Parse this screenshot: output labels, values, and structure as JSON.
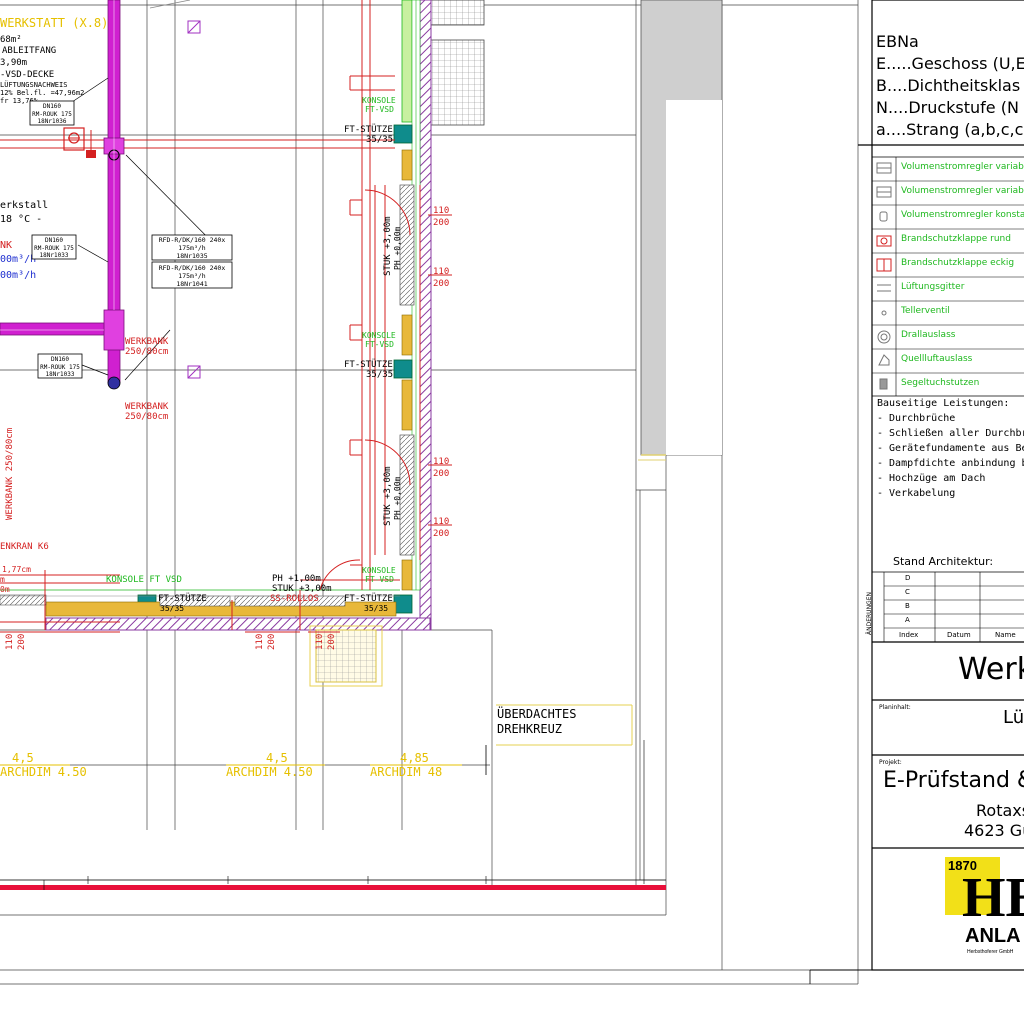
{
  "drawing": {
    "room_labels": {
      "werkstatt": "WERKSTATT (X.8)",
      "area": "68m²",
      "ableitfang": "ABLEITFANG",
      "decke": "-VSD-DECKE",
      "height": "3,90m",
      "nachweis": "LÜFTUNGSNACHWEIS",
      "belueft1": "12% Bel.fl. =47,96m2",
      "belueft2": "fr 13,76%",
      "lager": "erkstall",
      "temp": "18 °C -",
      "flow1": "00m³/h",
      "flow2": "00m³/h",
      "nk": "NK",
      "werkbank_left": "WERKBANK 250/80cm",
      "kran": "ENKRAN K6",
      "ueberdacht1": "ÜBERDACHTES",
      "ueberdacht2": "DREHKREUZ"
    },
    "tags": {
      "dn160a": [
        "DN160",
        "RM-ROUK 175",
        "18Nr1036"
      ],
      "dn160b": [
        "DN160",
        "RM-ROUK 175",
        "18Nr1033"
      ],
      "dn160c": [
        "DN160",
        "RM-ROUK 175",
        "18Nr1033"
      ],
      "rfd1": [
        "RFD-R/DK/160 240x",
        "175m³/h",
        "18Nr1035"
      ],
      "rfd2": [
        "RFD-R/DK/160 240x",
        "175m³/h",
        "18Nr1041"
      ]
    },
    "werkbank1": [
      "WERKBANK",
      "250/80cm"
    ],
    "werkbank2": [
      "WERKBANK",
      "250/80cm"
    ],
    "konsole": "KONSOLE",
    "konsole_vsd": "FT-VSD",
    "konsole_long": "KONSOLE FT VSD",
    "ft_stuetze": "FT-STÜTZE",
    "ft_dim": "35/35",
    "stuk": "STUK +3,00m",
    "ph": "PH +0,00m",
    "ph2": "PH +1,00m",
    "stuk2": "STUK +3,00m",
    "rollos": "SS-ROLLOS",
    "dims": {
      "a110": "110",
      "a200": "200",
      "b177": "1,77cm",
      "b_m": "m",
      "b_0m": "0m"
    },
    "archdim": [
      "4,5",
      "ARCHDIM 4.50",
      "4,5",
      "ARCHDIM 4.50",
      "4,85",
      "ARCHDIM 48"
    ]
  },
  "legend_header": {
    "title": "EBNa",
    "lines": [
      "E.....Geschoss (U,E",
      "B....Dichtheitsklas",
      "N....Druckstufe (N",
      "a....Strang (a,b,c,c"
    ]
  },
  "legend_rows": [
    {
      "label": "Volumenstromregler variabe",
      "color": "#1fb81f",
      "icon": "vvr-icon"
    },
    {
      "label": "Volumenstromregler variabe",
      "color": "#1fb81f",
      "icon": "vvr2-icon"
    },
    {
      "label": "Volumenstromregler konstan",
      "color": "#1fb81f",
      "icon": "kvr-icon"
    },
    {
      "label": "Brandschutzklappe rund",
      "color": "#1fb81f",
      "icon": "bsk-round-icon"
    },
    {
      "label": "Brandschutzklappe eckig",
      "color": "#1fb81f",
      "icon": "bsk-square-icon"
    },
    {
      "label": "Lüftungsgitter",
      "color": "#1fb81f",
      "icon": "grille-icon"
    },
    {
      "label": "Tellerventil",
      "color": "#1fb81f",
      "icon": "valve-icon"
    },
    {
      "label": "Drallauslass",
      "color": "#1fb81f",
      "icon": "swirl-icon"
    },
    {
      "label": "Quellluftauslass",
      "color": "#1fb81f",
      "icon": "displacement-icon"
    },
    {
      "label": "Segeltuchstutzen",
      "color": "#1fb81f",
      "icon": "canvas-icon"
    }
  ],
  "bauseitig": {
    "title": "Bauseitige Leistungen:",
    "items": [
      "- Durchbrüche",
      "- Schließen aller Durchbrüc",
      "- Gerätefundamente aus Be",
      "- Dampfdichte anbindung be",
      "- Hochzüge am Dach",
      "- Verkabelung"
    ]
  },
  "title_block": {
    "stand": "Stand Architektur:",
    "rev_rows": [
      "D",
      "C",
      "B",
      "A"
    ],
    "rev_side": "ÄNDERUNGEN",
    "rev_headers": [
      "Index",
      "Datum",
      "Name"
    ],
    "drawing_title": "Werk",
    "inhalt_label": "Planinhalt:",
    "inhalt": "Lüf",
    "projekt_label": "Projekt:",
    "projekt": "E-Prüfstand & E",
    "addr1": "Rotaxs",
    "addr2": "4623 Gu",
    "logo_year": "1870",
    "logo_letters": "HE",
    "logo_sub": "ANLA",
    "logo_tiny": "Herbsthoferer GmbH"
  }
}
